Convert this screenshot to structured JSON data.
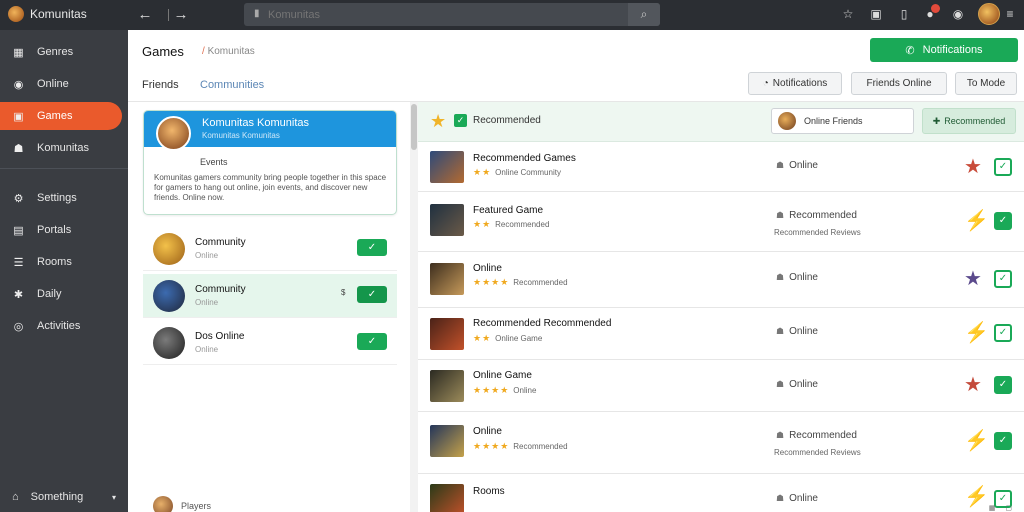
{
  "app": {
    "title": "Komunitas",
    "search_placeholder": "Komunitas"
  },
  "sidebar": {
    "items": [
      {
        "label": "Genres",
        "icon": "grid-icon",
        "active": false
      },
      {
        "label": "Online",
        "icon": "globe-icon",
        "active": false
      },
      {
        "label": "Games",
        "icon": "controller-icon",
        "active": true
      },
      {
        "label": "Komunitas",
        "icon": "people-icon",
        "active": false
      },
      {
        "label": "Settings",
        "icon": "gear-icon",
        "active": false
      },
      {
        "label": "Portals",
        "icon": "portal-icon",
        "active": false
      },
      {
        "label": "Rooms",
        "icon": "list-icon",
        "active": false
      },
      {
        "label": "Daily",
        "icon": "sparkle-icon",
        "active": false
      },
      {
        "label": "Activities",
        "icon": "activity-icon",
        "active": false
      }
    ],
    "bottom": {
      "label": "Something",
      "icon": "home-icon"
    }
  },
  "header": {
    "title": "Games",
    "subtitle": "Komunitas",
    "tab_primary": "Friends",
    "tab_secondary": "Communities",
    "primary_button": "Notifications",
    "buttons": [
      "Notifications",
      "Friends Online",
      "To Mode"
    ]
  },
  "featured": {
    "title": "Komunitas Komunitas",
    "subtitle": "Komunitas Komunitas",
    "name": "Events",
    "description": "Komunitas gamers community bring people together in this space for gamers to hang out online, join events, and discover new friends. Online now."
  },
  "left_list": [
    {
      "name": "Community",
      "status": "Online",
      "mark": "",
      "colors": [
        "#f3c14a",
        "#9a5e16"
      ],
      "check_dark": false
    },
    {
      "name": "Community",
      "status": "Online",
      "mark": "$",
      "colors": [
        "#3c6bb0",
        "#20273a"
      ],
      "check_dark": true
    },
    {
      "name": "Dos Online",
      "status": "Online",
      "mark": "",
      "colors": [
        "#7b7b7b",
        "#1e1e1e"
      ],
      "check_dark": false
    }
  ],
  "left_footer": "Players",
  "right": {
    "title": "Recommended",
    "select_value": "Online Friends",
    "button_label": "Recommended",
    "rows": [
      {
        "title": "Recommended Games",
        "stars": "★★",
        "count": "Online Community",
        "status": "Online",
        "status2": "",
        "icon": "★",
        "icon_color": "#c94c3a",
        "checked": false,
        "thumb": [
          "#2e4a7a",
          "#b36a30"
        ]
      },
      {
        "title": "Featured Game",
        "stars": "★★",
        "count": "Recommended",
        "status": "Recommended",
        "status2": "Recommended Reviews",
        "icon": "⚡",
        "icon_color": "#e8b12e",
        "checked": true,
        "thumb": [
          "#1f3040",
          "#6b5a48"
        ]
      },
      {
        "title": "Online",
        "stars": "★★★★",
        "count": "Recommended",
        "status": "Online",
        "status2": "",
        "icon": "★",
        "icon_color": "#5b4a8c",
        "checked": false,
        "thumb": [
          "#3d2e1e",
          "#c69a5a"
        ]
      },
      {
        "title": "Recommended Recommended",
        "stars": "★★",
        "count": "Online Game",
        "status": "Online",
        "status2": "",
        "icon": "⚡",
        "icon_color": "#e5b24a",
        "checked": false,
        "thumb": [
          "#4a2218",
          "#c2512a"
        ]
      },
      {
        "title": "Online Game",
        "stars": "★★★★",
        "count": "Online",
        "status": "Online",
        "status2": "",
        "icon": "★",
        "icon_color": "#c44b3b",
        "checked": true,
        "thumb": [
          "#2b2a22",
          "#9c8b5a"
        ]
      },
      {
        "title": "Online",
        "stars": "★★★★",
        "count": "Recommended",
        "status": "Recommended",
        "status2": "Recommended Reviews",
        "icon": "⚡",
        "icon_color": "#e8b12e",
        "checked": true,
        "thumb": [
          "#23355a",
          "#c5a24a"
        ]
      },
      {
        "title": "Rooms",
        "stars": "",
        "count": "",
        "status": "Online",
        "status2": "",
        "icon": "⚡",
        "icon_color": "#e8b12e",
        "checked": true,
        "thumb": [
          "#2a3a18",
          "#c2512a"
        ]
      }
    ]
  },
  "colors": {
    "accent": "#ea5a2c",
    "primary": "#1aa957",
    "info": "#1e95dd"
  }
}
